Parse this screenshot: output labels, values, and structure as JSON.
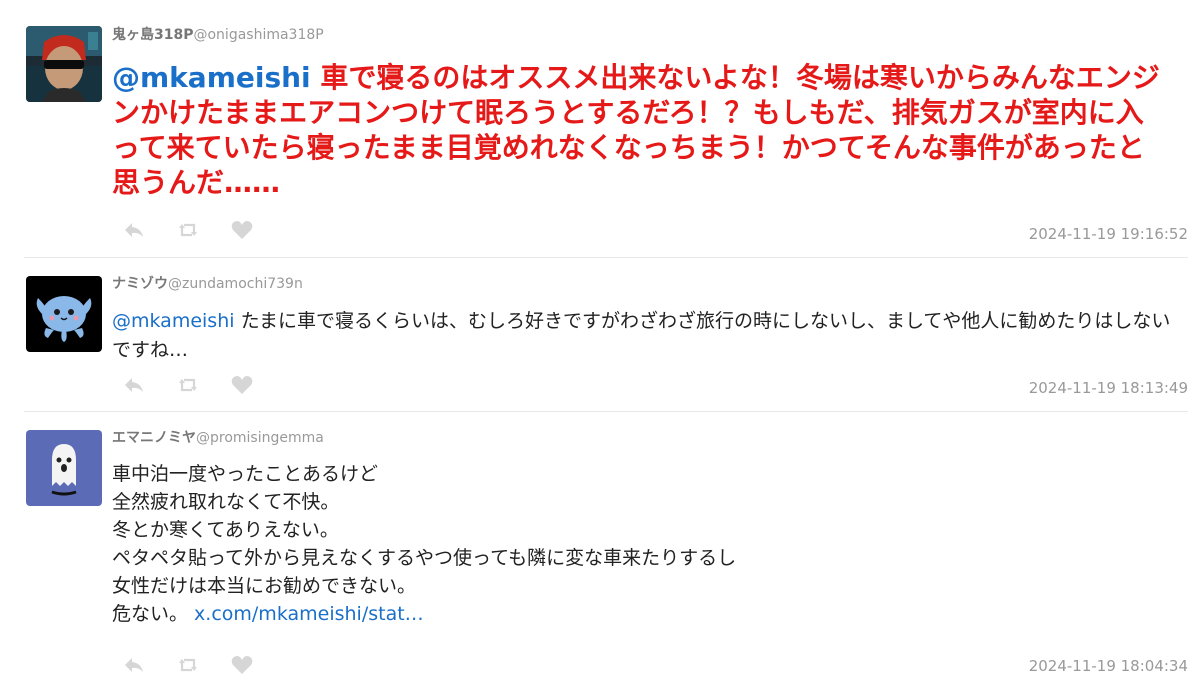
{
  "tweets": [
    {
      "display_name": "鬼ヶ島318P",
      "handle": "@onigashima318P",
      "mention": "@mkameishi",
      "text": " 車で寝るのはオススメ出来ないよな！冬場は寒いからみんなエンジンかけたままエアコンつけて眠ろうとするだろ！？もしもだ、排気ガスが室内に入って来ていたら寝ったまま目覚めれなくなっちまう！かつてそんな事件があったと思うんだ……",
      "timestamp": "2024-11-19 19:16:52"
    },
    {
      "display_name": "ナミゾウ",
      "handle": "@zundamochi739n",
      "mention": "@mkameishi",
      "text": " たまに車で寝るくらいは、むしろ好きですがわざわざ旅行の時にしないし、ましてや他人に勧めたりはしないですね…",
      "timestamp": "2024-11-19 18:13:49"
    },
    {
      "display_name": "エマニノミヤ",
      "handle": "@promisingemma",
      "lines": [
        "車中泊一度やったことあるけど",
        "全然疲れ取れなくて不快。",
        "冬とか寒くてありえない。",
        "ペタペタ貼って外から見えなくするやつ使っても隣に変な車来たりするし",
        "女性だけは本当にお勧めできない。"
      ],
      "last_line_text": "危ない。 ",
      "link": "x.com/mkameishi/stat…",
      "timestamp": "2024-11-19 18:04:34"
    }
  ],
  "icons": {
    "reply": "reply-icon",
    "retweet": "retweet-icon",
    "like": "heart-icon"
  },
  "colors": {
    "emphasis_text": "#e61919",
    "link": "#1a6fc9",
    "meta_text": "#999999",
    "action_icons": "#d6d6d6"
  }
}
